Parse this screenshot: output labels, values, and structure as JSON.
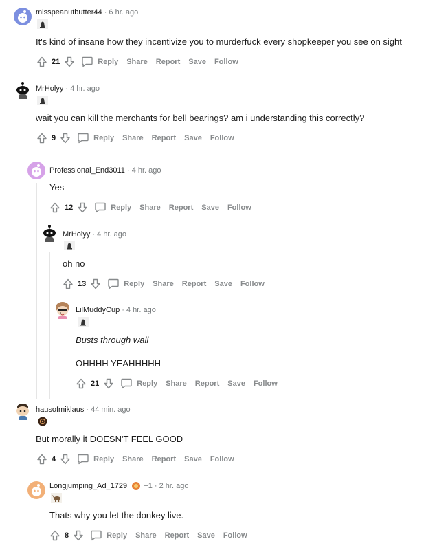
{
  "comments": [
    {
      "author": "misspeanutbutter44",
      "time": "6 hr. ago",
      "body": [
        "It's kind of insane how they incentivize you to murderfuck every shopkeeper you see on sight"
      ],
      "score": "21",
      "flair_icon": "bell-icon"
    },
    {
      "author": "MrHolyy",
      "time": "4 hr. ago",
      "body": [
        "wait you can kill the merchants for bell bearings? am i understanding this correctly?"
      ],
      "score": "9",
      "flair_icon": "bell-icon"
    },
    {
      "author": "Professional_End3011",
      "time": "4 hr. ago",
      "body": [
        "Yes"
      ],
      "score": "12"
    },
    {
      "author": "MrHolyy",
      "time": "4 hr. ago",
      "body": [
        "oh no"
      ],
      "score": "13",
      "flair_icon": "bell-icon"
    },
    {
      "author": "LilMuddyCup",
      "time": "4 hr. ago",
      "body": [
        "Busts through wall",
        "OHHHH YEAHHHHH"
      ],
      "score": "21",
      "flair_icon": "bell-icon"
    },
    {
      "author": "hausofmiklaus",
      "time": "44 min. ago",
      "body": [
        "But morally it DOESN'T FEEL GOOD"
      ],
      "score": "4",
      "flair_icon": "rune-icon"
    },
    {
      "author": "Longjumping_Ad_1729",
      "time": "2 hr. ago",
      "award_count": "+1",
      "body": [
        "Thats why you let the donkey live."
      ],
      "score": "8",
      "flair_icon": "donkey-icon"
    }
  ],
  "actions": {
    "reply": "Reply",
    "share": "Share",
    "report": "Report",
    "save": "Save",
    "follow": "Follow"
  },
  "colors": {
    "muted": "#878a8c",
    "thread_line": "#e5e5e5",
    "text": "#1c1c1c"
  }
}
